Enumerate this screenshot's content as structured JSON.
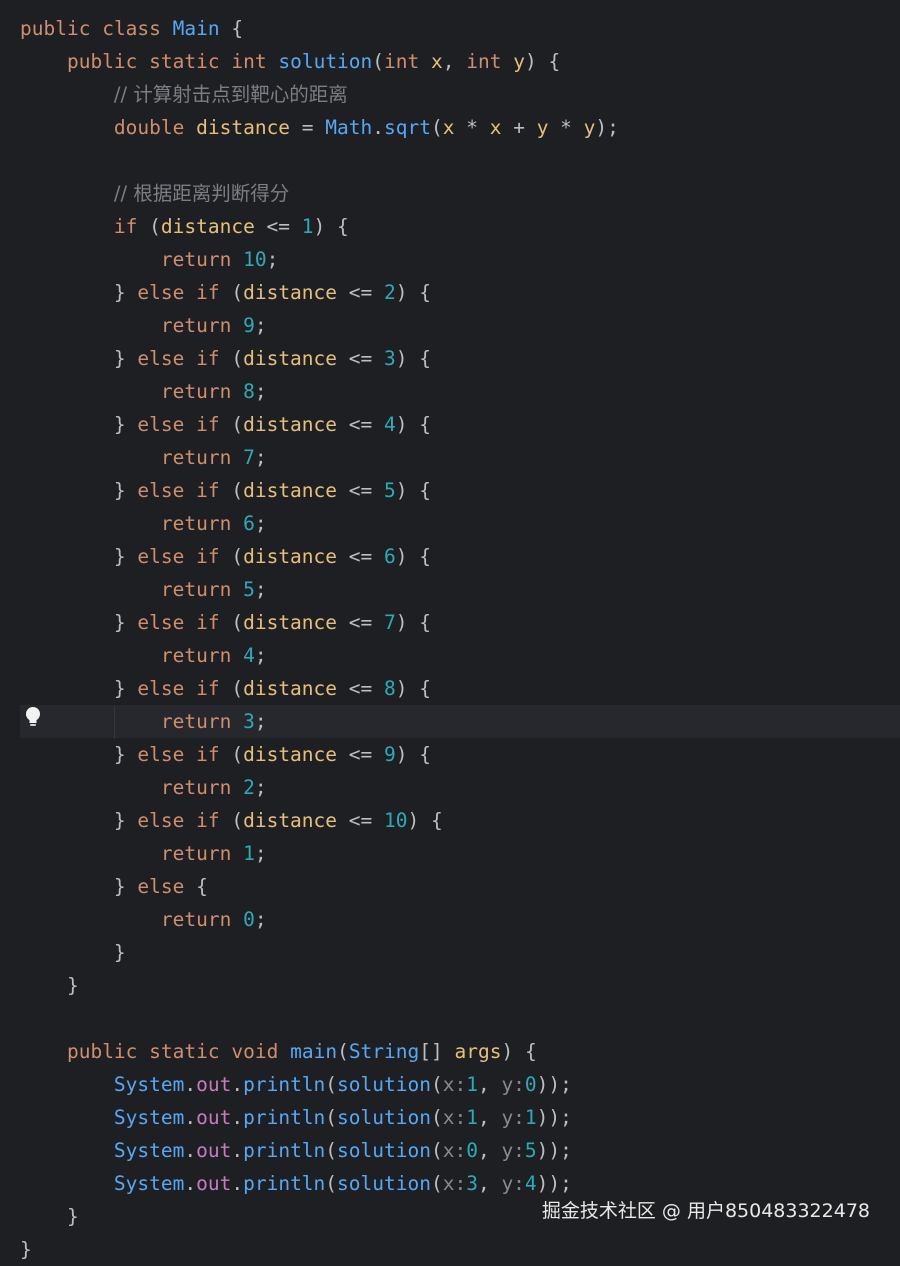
{
  "editor": {
    "lines": [
      {
        "parts": [
          [
            "kw",
            "public"
          ],
          [
            "plain",
            " "
          ],
          [
            "kw",
            "class"
          ],
          [
            "plain",
            " "
          ],
          [
            "fn",
            "Main"
          ],
          [
            "plain",
            " {"
          ]
        ]
      },
      {
        "parts": [
          [
            "plain",
            "    "
          ],
          [
            "kw",
            "public"
          ],
          [
            "plain",
            " "
          ],
          [
            "kw",
            "static"
          ],
          [
            "plain",
            " "
          ],
          [
            "kw",
            "int"
          ],
          [
            "plain",
            " "
          ],
          [
            "fn",
            "solution"
          ],
          [
            "plain",
            "("
          ],
          [
            "kw",
            "int"
          ],
          [
            "plain",
            " "
          ],
          [
            "param",
            "x"
          ],
          [
            "plain",
            ", "
          ],
          [
            "kw",
            "int"
          ],
          [
            "plain",
            " "
          ],
          [
            "param",
            "y"
          ],
          [
            "plain",
            ") {"
          ]
        ]
      },
      {
        "parts": [
          [
            "plain",
            "        "
          ],
          [
            "cmt",
            "// 计算射击点到靶心的距离"
          ]
        ]
      },
      {
        "parts": [
          [
            "plain",
            "        "
          ],
          [
            "kw",
            "double"
          ],
          [
            "plain",
            " "
          ],
          [
            "param",
            "distance"
          ],
          [
            "plain",
            " = "
          ],
          [
            "lib",
            "Math"
          ],
          [
            "plain",
            "."
          ],
          [
            "fn",
            "sqrt"
          ],
          [
            "plain",
            "("
          ],
          [
            "param",
            "x"
          ],
          [
            "plain",
            " * "
          ],
          [
            "param",
            "x"
          ],
          [
            "plain",
            " + "
          ],
          [
            "param",
            "y"
          ],
          [
            "plain",
            " * "
          ],
          [
            "param",
            "y"
          ],
          [
            "plain",
            ");"
          ]
        ]
      },
      {
        "parts": [
          [
            "plain",
            ""
          ]
        ]
      },
      {
        "parts": [
          [
            "plain",
            "        "
          ],
          [
            "cmt",
            "// 根据距离判断得分"
          ]
        ]
      },
      {
        "parts": [
          [
            "plain",
            "        "
          ],
          [
            "kw",
            "if"
          ],
          [
            "plain",
            " ("
          ],
          [
            "param",
            "distance"
          ],
          [
            "plain",
            " <= "
          ],
          [
            "num",
            "1"
          ],
          [
            "plain",
            ") {"
          ]
        ]
      },
      {
        "parts": [
          [
            "plain",
            "            "
          ],
          [
            "kw",
            "return"
          ],
          [
            "plain",
            " "
          ],
          [
            "num",
            "10"
          ],
          [
            "plain",
            ";"
          ]
        ]
      },
      {
        "parts": [
          [
            "plain",
            "        } "
          ],
          [
            "kw",
            "else"
          ],
          [
            "plain",
            " "
          ],
          [
            "kw",
            "if"
          ],
          [
            "plain",
            " ("
          ],
          [
            "param",
            "distance"
          ],
          [
            "plain",
            " <= "
          ],
          [
            "num",
            "2"
          ],
          [
            "plain",
            ") {"
          ]
        ]
      },
      {
        "parts": [
          [
            "plain",
            "            "
          ],
          [
            "kw",
            "return"
          ],
          [
            "plain",
            " "
          ],
          [
            "num",
            "9"
          ],
          [
            "plain",
            ";"
          ]
        ]
      },
      {
        "parts": [
          [
            "plain",
            "        } "
          ],
          [
            "kw",
            "else"
          ],
          [
            "plain",
            " "
          ],
          [
            "kw",
            "if"
          ],
          [
            "plain",
            " ("
          ],
          [
            "param",
            "distance"
          ],
          [
            "plain",
            " <= "
          ],
          [
            "num",
            "3"
          ],
          [
            "plain",
            ") {"
          ]
        ]
      },
      {
        "parts": [
          [
            "plain",
            "            "
          ],
          [
            "kw",
            "return"
          ],
          [
            "plain",
            " "
          ],
          [
            "num",
            "8"
          ],
          [
            "plain",
            ";"
          ]
        ]
      },
      {
        "parts": [
          [
            "plain",
            "        } "
          ],
          [
            "kw",
            "else"
          ],
          [
            "plain",
            " "
          ],
          [
            "kw",
            "if"
          ],
          [
            "plain",
            " ("
          ],
          [
            "param",
            "distance"
          ],
          [
            "plain",
            " <= "
          ],
          [
            "num",
            "4"
          ],
          [
            "plain",
            ") {"
          ]
        ]
      },
      {
        "parts": [
          [
            "plain",
            "            "
          ],
          [
            "kw",
            "return"
          ],
          [
            "plain",
            " "
          ],
          [
            "num",
            "7"
          ],
          [
            "plain",
            ";"
          ]
        ]
      },
      {
        "parts": [
          [
            "plain",
            "        } "
          ],
          [
            "kw",
            "else"
          ],
          [
            "plain",
            " "
          ],
          [
            "kw",
            "if"
          ],
          [
            "plain",
            " ("
          ],
          [
            "param",
            "distance"
          ],
          [
            "plain",
            " <= "
          ],
          [
            "num",
            "5"
          ],
          [
            "plain",
            ") {"
          ]
        ]
      },
      {
        "parts": [
          [
            "plain",
            "            "
          ],
          [
            "kw",
            "return"
          ],
          [
            "plain",
            " "
          ],
          [
            "num",
            "6"
          ],
          [
            "plain",
            ";"
          ]
        ]
      },
      {
        "parts": [
          [
            "plain",
            "        } "
          ],
          [
            "kw",
            "else"
          ],
          [
            "plain",
            " "
          ],
          [
            "kw",
            "if"
          ],
          [
            "plain",
            " ("
          ],
          [
            "param",
            "distance"
          ],
          [
            "plain",
            " <= "
          ],
          [
            "num",
            "6"
          ],
          [
            "plain",
            ") {"
          ]
        ]
      },
      {
        "parts": [
          [
            "plain",
            "            "
          ],
          [
            "kw",
            "return"
          ],
          [
            "plain",
            " "
          ],
          [
            "num",
            "5"
          ],
          [
            "plain",
            ";"
          ]
        ]
      },
      {
        "parts": [
          [
            "plain",
            "        } "
          ],
          [
            "kw",
            "else"
          ],
          [
            "plain",
            " "
          ],
          [
            "kw",
            "if"
          ],
          [
            "plain",
            " ("
          ],
          [
            "param",
            "distance"
          ],
          [
            "plain",
            " <= "
          ],
          [
            "num",
            "7"
          ],
          [
            "plain",
            ") {"
          ]
        ]
      },
      {
        "parts": [
          [
            "plain",
            "            "
          ],
          [
            "kw",
            "return"
          ],
          [
            "plain",
            " "
          ],
          [
            "num",
            "4"
          ],
          [
            "plain",
            ";"
          ]
        ]
      },
      {
        "parts": [
          [
            "plain",
            "        } "
          ],
          [
            "kw",
            "else"
          ],
          [
            "plain",
            " "
          ],
          [
            "kw",
            "if"
          ],
          [
            "plain",
            " ("
          ],
          [
            "param",
            "distance"
          ],
          [
            "plain",
            " <= "
          ],
          [
            "num",
            "8"
          ],
          [
            "plain",
            ") {"
          ]
        ]
      },
      {
        "parts": [
          [
            "plain",
            "            "
          ],
          [
            "kw",
            "return"
          ],
          [
            "plain",
            " "
          ],
          [
            "num",
            "3"
          ],
          [
            "plain",
            ";"
          ]
        ],
        "current": true
      },
      {
        "parts": [
          [
            "plain",
            "        } "
          ],
          [
            "kw",
            "else"
          ],
          [
            "plain",
            " "
          ],
          [
            "kw",
            "if"
          ],
          [
            "plain",
            " ("
          ],
          [
            "param",
            "distance"
          ],
          [
            "plain",
            " <= "
          ],
          [
            "num",
            "9"
          ],
          [
            "plain",
            ") {"
          ]
        ]
      },
      {
        "parts": [
          [
            "plain",
            "            "
          ],
          [
            "kw",
            "return"
          ],
          [
            "plain",
            " "
          ],
          [
            "num",
            "2"
          ],
          [
            "plain",
            ";"
          ]
        ]
      },
      {
        "parts": [
          [
            "plain",
            "        } "
          ],
          [
            "kw",
            "else"
          ],
          [
            "plain",
            " "
          ],
          [
            "kw",
            "if"
          ],
          [
            "plain",
            " ("
          ],
          [
            "param",
            "distance"
          ],
          [
            "plain",
            " <= "
          ],
          [
            "num",
            "10"
          ],
          [
            "plain",
            ") {"
          ]
        ]
      },
      {
        "parts": [
          [
            "plain",
            "            "
          ],
          [
            "kw",
            "return"
          ],
          [
            "plain",
            " "
          ],
          [
            "num",
            "1"
          ],
          [
            "plain",
            ";"
          ]
        ]
      },
      {
        "parts": [
          [
            "plain",
            "        } "
          ],
          [
            "kw",
            "else"
          ],
          [
            "plain",
            " {"
          ]
        ]
      },
      {
        "parts": [
          [
            "plain",
            "            "
          ],
          [
            "kw",
            "return"
          ],
          [
            "plain",
            " "
          ],
          [
            "num",
            "0"
          ],
          [
            "plain",
            ";"
          ]
        ]
      },
      {
        "parts": [
          [
            "plain",
            "        }"
          ]
        ]
      },
      {
        "parts": [
          [
            "plain",
            "    }"
          ]
        ]
      },
      {
        "parts": [
          [
            "plain",
            ""
          ]
        ]
      },
      {
        "parts": [
          [
            "plain",
            "    "
          ],
          [
            "kw",
            "public"
          ],
          [
            "plain",
            " "
          ],
          [
            "kw",
            "static"
          ],
          [
            "plain",
            " "
          ],
          [
            "kw",
            "void"
          ],
          [
            "plain",
            " "
          ],
          [
            "fn",
            "main"
          ],
          [
            "plain",
            "("
          ],
          [
            "lib",
            "String"
          ],
          [
            "plain",
            "[] "
          ],
          [
            "param",
            "args"
          ],
          [
            "plain",
            ") {"
          ]
        ]
      },
      {
        "parts": [
          [
            "plain",
            "        "
          ],
          [
            "lib",
            "System"
          ],
          [
            "plain",
            "."
          ],
          [
            "field",
            "out"
          ],
          [
            "plain",
            "."
          ],
          [
            "fn",
            "println"
          ],
          [
            "plain",
            "("
          ],
          [
            "fn",
            "solution"
          ],
          [
            "plain",
            "("
          ],
          [
            "hint",
            "x:"
          ],
          [
            "num",
            "1"
          ],
          [
            "plain",
            ", "
          ],
          [
            "hint",
            "y:"
          ],
          [
            "num",
            "0"
          ],
          [
            "plain",
            "));"
          ]
        ]
      },
      {
        "parts": [
          [
            "plain",
            "        "
          ],
          [
            "lib",
            "System"
          ],
          [
            "plain",
            "."
          ],
          [
            "field",
            "out"
          ],
          [
            "plain",
            "."
          ],
          [
            "fn",
            "println"
          ],
          [
            "plain",
            "("
          ],
          [
            "fn",
            "solution"
          ],
          [
            "plain",
            "("
          ],
          [
            "hint",
            "x:"
          ],
          [
            "num",
            "1"
          ],
          [
            "plain",
            ", "
          ],
          [
            "hint",
            "y:"
          ],
          [
            "num",
            "1"
          ],
          [
            "plain",
            "));"
          ]
        ]
      },
      {
        "parts": [
          [
            "plain",
            "        "
          ],
          [
            "lib",
            "System"
          ],
          [
            "plain",
            "."
          ],
          [
            "field",
            "out"
          ],
          [
            "plain",
            "."
          ],
          [
            "fn",
            "println"
          ],
          [
            "plain",
            "("
          ],
          [
            "fn",
            "solution"
          ],
          [
            "plain",
            "("
          ],
          [
            "hint",
            "x:"
          ],
          [
            "num",
            "0"
          ],
          [
            "plain",
            ", "
          ],
          [
            "hint",
            "y:"
          ],
          [
            "num",
            "5"
          ],
          [
            "plain",
            "));"
          ]
        ]
      },
      {
        "parts": [
          [
            "plain",
            "        "
          ],
          [
            "lib",
            "System"
          ],
          [
            "plain",
            "."
          ],
          [
            "field",
            "out"
          ],
          [
            "plain",
            "."
          ],
          [
            "fn",
            "println"
          ],
          [
            "plain",
            "("
          ],
          [
            "fn",
            "solution"
          ],
          [
            "plain",
            "("
          ],
          [
            "hint",
            "x:"
          ],
          [
            "num",
            "3"
          ],
          [
            "plain",
            ", "
          ],
          [
            "hint",
            "y:"
          ],
          [
            "num",
            "4"
          ],
          [
            "plain",
            "));"
          ]
        ]
      },
      {
        "parts": [
          [
            "plain",
            "    }"
          ]
        ]
      },
      {
        "parts": [
          [
            "plain",
            "}"
          ]
        ]
      }
    ]
  },
  "gutter": {
    "icon": "lightbulb-icon"
  },
  "watermark": "掘金技术社区 @ 用户850483322478",
  "colors": {
    "background": "#1e1f22",
    "current_line": "#26282e",
    "keyword": "#cf8e6d",
    "function": "#56a8f5",
    "number": "#2aacb8",
    "comment": "#7a7e85",
    "parameter": "#e6c07b"
  }
}
